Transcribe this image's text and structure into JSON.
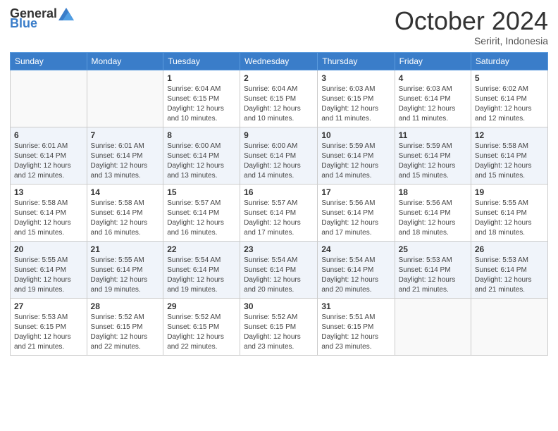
{
  "logo": {
    "general": "General",
    "blue": "Blue"
  },
  "title": {
    "month_year": "October 2024",
    "location": "Seririt, Indonesia"
  },
  "weekdays": [
    "Sunday",
    "Monday",
    "Tuesday",
    "Wednesday",
    "Thursday",
    "Friday",
    "Saturday"
  ],
  "weeks": [
    [
      {
        "day": "",
        "info": ""
      },
      {
        "day": "",
        "info": ""
      },
      {
        "day": "1",
        "info": "Sunrise: 6:04 AM\nSunset: 6:15 PM\nDaylight: 12 hours and 10 minutes."
      },
      {
        "day": "2",
        "info": "Sunrise: 6:04 AM\nSunset: 6:15 PM\nDaylight: 12 hours and 10 minutes."
      },
      {
        "day": "3",
        "info": "Sunrise: 6:03 AM\nSunset: 6:15 PM\nDaylight: 12 hours and 11 minutes."
      },
      {
        "day": "4",
        "info": "Sunrise: 6:03 AM\nSunset: 6:14 PM\nDaylight: 12 hours and 11 minutes."
      },
      {
        "day": "5",
        "info": "Sunrise: 6:02 AM\nSunset: 6:14 PM\nDaylight: 12 hours and 12 minutes."
      }
    ],
    [
      {
        "day": "6",
        "info": "Sunrise: 6:01 AM\nSunset: 6:14 PM\nDaylight: 12 hours and 12 minutes."
      },
      {
        "day": "7",
        "info": "Sunrise: 6:01 AM\nSunset: 6:14 PM\nDaylight: 12 hours and 13 minutes."
      },
      {
        "day": "8",
        "info": "Sunrise: 6:00 AM\nSunset: 6:14 PM\nDaylight: 12 hours and 13 minutes."
      },
      {
        "day": "9",
        "info": "Sunrise: 6:00 AM\nSunset: 6:14 PM\nDaylight: 12 hours and 14 minutes."
      },
      {
        "day": "10",
        "info": "Sunrise: 5:59 AM\nSunset: 6:14 PM\nDaylight: 12 hours and 14 minutes."
      },
      {
        "day": "11",
        "info": "Sunrise: 5:59 AM\nSunset: 6:14 PM\nDaylight: 12 hours and 15 minutes."
      },
      {
        "day": "12",
        "info": "Sunrise: 5:58 AM\nSunset: 6:14 PM\nDaylight: 12 hours and 15 minutes."
      }
    ],
    [
      {
        "day": "13",
        "info": "Sunrise: 5:58 AM\nSunset: 6:14 PM\nDaylight: 12 hours and 15 minutes."
      },
      {
        "day": "14",
        "info": "Sunrise: 5:58 AM\nSunset: 6:14 PM\nDaylight: 12 hours and 16 minutes."
      },
      {
        "day": "15",
        "info": "Sunrise: 5:57 AM\nSunset: 6:14 PM\nDaylight: 12 hours and 16 minutes."
      },
      {
        "day": "16",
        "info": "Sunrise: 5:57 AM\nSunset: 6:14 PM\nDaylight: 12 hours and 17 minutes."
      },
      {
        "day": "17",
        "info": "Sunrise: 5:56 AM\nSunset: 6:14 PM\nDaylight: 12 hours and 17 minutes."
      },
      {
        "day": "18",
        "info": "Sunrise: 5:56 AM\nSunset: 6:14 PM\nDaylight: 12 hours and 18 minutes."
      },
      {
        "day": "19",
        "info": "Sunrise: 5:55 AM\nSunset: 6:14 PM\nDaylight: 12 hours and 18 minutes."
      }
    ],
    [
      {
        "day": "20",
        "info": "Sunrise: 5:55 AM\nSunset: 6:14 PM\nDaylight: 12 hours and 19 minutes."
      },
      {
        "day": "21",
        "info": "Sunrise: 5:55 AM\nSunset: 6:14 PM\nDaylight: 12 hours and 19 minutes."
      },
      {
        "day": "22",
        "info": "Sunrise: 5:54 AM\nSunset: 6:14 PM\nDaylight: 12 hours and 19 minutes."
      },
      {
        "day": "23",
        "info": "Sunrise: 5:54 AM\nSunset: 6:14 PM\nDaylight: 12 hours and 20 minutes."
      },
      {
        "day": "24",
        "info": "Sunrise: 5:54 AM\nSunset: 6:14 PM\nDaylight: 12 hours and 20 minutes."
      },
      {
        "day": "25",
        "info": "Sunrise: 5:53 AM\nSunset: 6:14 PM\nDaylight: 12 hours and 21 minutes."
      },
      {
        "day": "26",
        "info": "Sunrise: 5:53 AM\nSunset: 6:14 PM\nDaylight: 12 hours and 21 minutes."
      }
    ],
    [
      {
        "day": "27",
        "info": "Sunrise: 5:53 AM\nSunset: 6:15 PM\nDaylight: 12 hours and 21 minutes."
      },
      {
        "day": "28",
        "info": "Sunrise: 5:52 AM\nSunset: 6:15 PM\nDaylight: 12 hours and 22 minutes."
      },
      {
        "day": "29",
        "info": "Sunrise: 5:52 AM\nSunset: 6:15 PM\nDaylight: 12 hours and 22 minutes."
      },
      {
        "day": "30",
        "info": "Sunrise: 5:52 AM\nSunset: 6:15 PM\nDaylight: 12 hours and 23 minutes."
      },
      {
        "day": "31",
        "info": "Sunrise: 5:51 AM\nSunset: 6:15 PM\nDaylight: 12 hours and 23 minutes."
      },
      {
        "day": "",
        "info": ""
      },
      {
        "day": "",
        "info": ""
      }
    ]
  ]
}
